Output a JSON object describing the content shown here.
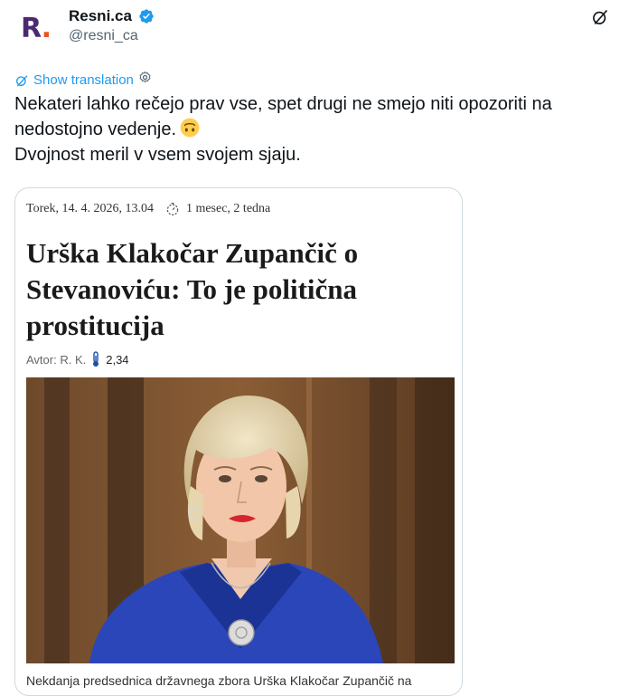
{
  "author": {
    "display_name": "Resni.ca",
    "handle": "@resni_ca",
    "avatar_logo": "R",
    "avatar_dot": ".",
    "verified": true,
    "colors": {
      "logo": "#4a2a72",
      "dot": "#e8541f",
      "verified": "#1d9bf0"
    }
  },
  "translate": {
    "label": "Show translation"
  },
  "tweet": {
    "line1": "Nekateri lahko rečejo prav vse, spet drugi ne smejo niti opozoriti na nedostojno vedenje.",
    "line2": "Dvojnost meril v vsem svojem sjaju.",
    "emoji": "upside-down-face"
  },
  "card": {
    "date": "Torek, 14. 4. 2026, 13.04",
    "read_time": "1 mesec, 2 tedna",
    "headline": "Urška Klakočar Zupančič o Stevanoviću: To je politična prostitucija",
    "author_label": "Avtor: R. K.",
    "score": "2,34",
    "photo_alt": "woman-in-blue-jacket-portrait",
    "caption": "Nekdanja predsednica državnega zbora Urška Klakočar Zupančič na"
  }
}
